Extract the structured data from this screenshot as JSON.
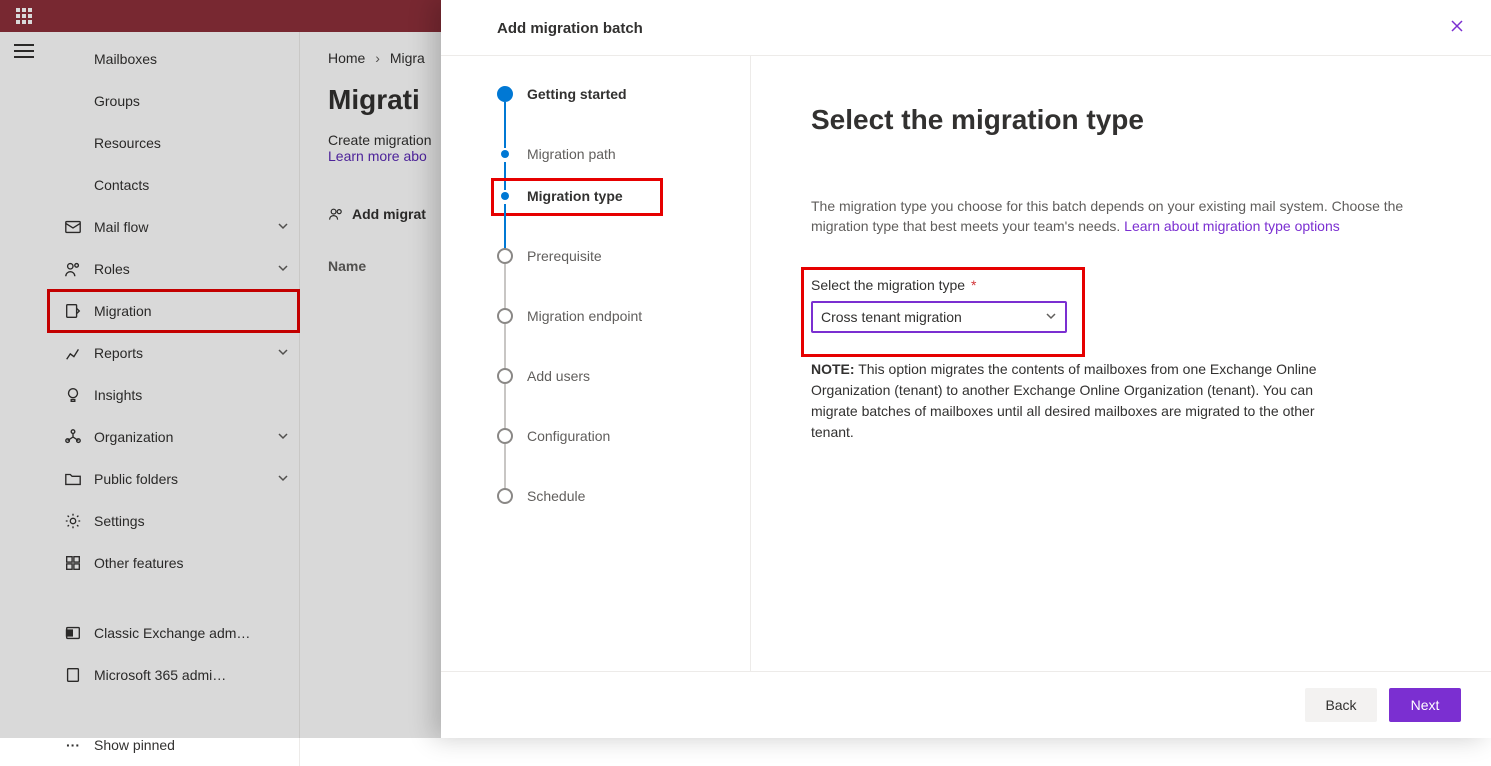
{
  "sidebar": {
    "items": [
      {
        "label": "Mailboxes",
        "icon": ""
      },
      {
        "label": "Groups",
        "icon": ""
      },
      {
        "label": "Resources",
        "icon": ""
      },
      {
        "label": "Contacts",
        "icon": ""
      },
      {
        "label": "Mail flow",
        "icon": "mail"
      },
      {
        "label": "Roles",
        "icon": "roles"
      },
      {
        "label": "Migration",
        "icon": "migration"
      },
      {
        "label": "Reports",
        "icon": "reports"
      },
      {
        "label": "Insights",
        "icon": "insights"
      },
      {
        "label": "Organization",
        "icon": "org"
      },
      {
        "label": "Public folders",
        "icon": "folders"
      },
      {
        "label": "Settings",
        "icon": "settings"
      },
      {
        "label": "Other features",
        "icon": "other"
      },
      {
        "label": "Classic Exchange adm…",
        "icon": "classic"
      },
      {
        "label": "Microsoft 365 admi…",
        "icon": "m365"
      },
      {
        "label": "Show pinned",
        "icon": "dots"
      }
    ]
  },
  "breadcrumb": {
    "home": "Home",
    "current": "Migra"
  },
  "page": {
    "title": "Migrati",
    "desc_line1": "Create migration",
    "learn_more": "Learn more abo",
    "add_action": "Add migrat",
    "table_col_name": "Name"
  },
  "flyout": {
    "title": "Add migration batch",
    "steps": [
      {
        "label": "Getting started"
      },
      {
        "label": "Migration path"
      },
      {
        "label": "Migration type"
      },
      {
        "label": "Prerequisite"
      },
      {
        "label": "Migration endpoint"
      },
      {
        "label": "Add users"
      },
      {
        "label": "Configuration"
      },
      {
        "label": "Schedule"
      }
    ],
    "content": {
      "heading": "Select the migration type",
      "desc": "The migration type you choose for this batch depends on your existing mail system. Choose the migration type that best meets your team's needs. ",
      "desc_link": "Learn about migration type options",
      "field_label": "Select the migration type",
      "select_value": "Cross tenant migration",
      "note_label": "NOTE:",
      "note_text": " This option migrates the contents of mailboxes from one Exchange Online Organization (tenant) to another Exchange Online Organization (tenant). You can migrate batches of mailboxes until all desired mailboxes are migrated to the other tenant."
    },
    "buttons": {
      "back": "Back",
      "next": "Next"
    }
  }
}
